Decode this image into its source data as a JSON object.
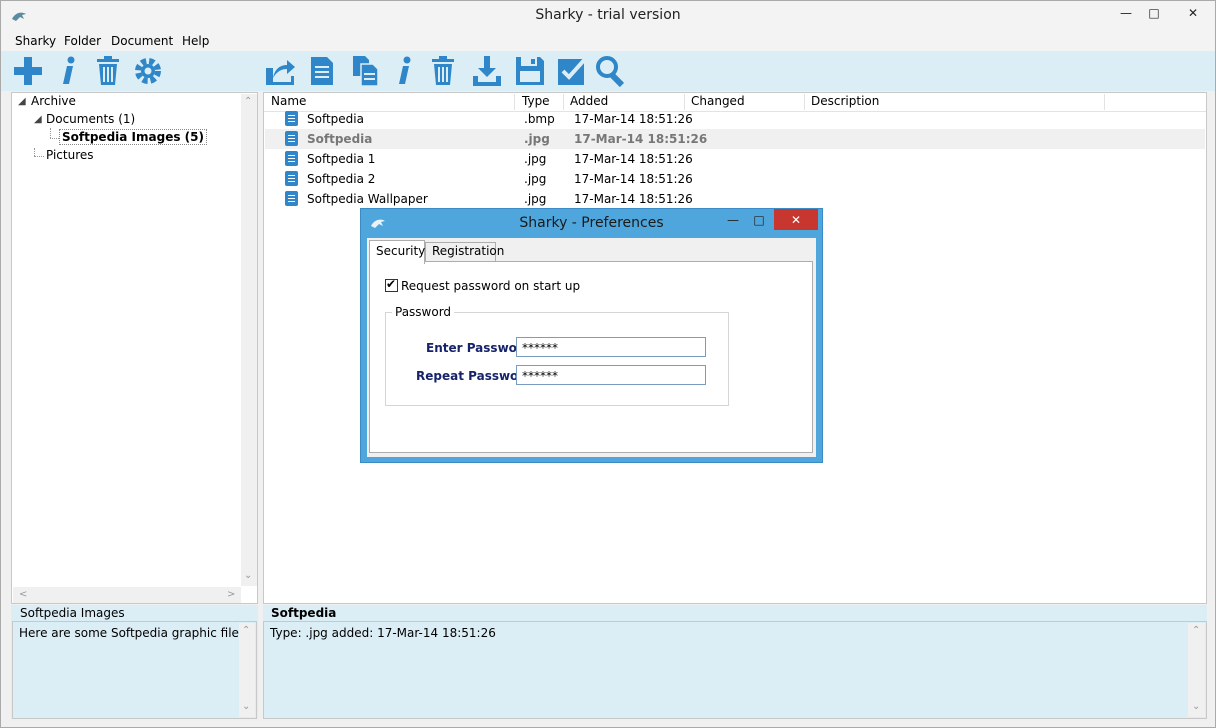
{
  "window": {
    "title": "Sharky - trial version"
  },
  "menu": [
    "Sharky",
    "Folder",
    "Document",
    "Help"
  ],
  "toolbar_left": [
    "add-icon",
    "info-icon",
    "trash-icon",
    "gear-icon"
  ],
  "toolbar_right": [
    "export-icon",
    "document-icon",
    "copy-icon",
    "info-icon",
    "trash-icon",
    "download-icon",
    "save-icon",
    "check-icon",
    "search-icon"
  ],
  "tree": {
    "root": "Archive",
    "children": [
      {
        "label": "Documents (1)"
      },
      {
        "label": "Softpedia Images (5)",
        "selected": true
      },
      {
        "label": "Pictures"
      }
    ]
  },
  "file_list": {
    "columns": [
      "Name",
      "Type",
      "Added",
      "Changed",
      "Description"
    ],
    "rows": [
      {
        "name": "Softpedia",
        "type": ".bmp",
        "added": "17-Mar-14 18:51:26"
      },
      {
        "name": "Softpedia",
        "type": ".jpg",
        "added": "17-Mar-14 18:51:26",
        "selected": true
      },
      {
        "name": "Softpedia 1",
        "type": ".jpg",
        "added": "17-Mar-14 18:51:26"
      },
      {
        "name": "Softpedia 2",
        "type": ".jpg",
        "added": "17-Mar-14 18:51:26"
      },
      {
        "name": "Softpedia Wallpaper",
        "type": ".jpg",
        "added": "17-Mar-14 18:51:26"
      }
    ]
  },
  "bottom_left": {
    "title": "Softpedia Images",
    "note": "Here are some Softpedia graphic files"
  },
  "bottom_right": {
    "title": "Softpedia",
    "note": "Type: .jpg added: 17-Mar-14 18:51:26"
  },
  "dialog": {
    "title": "Sharky - Preferences",
    "tabs": [
      "Security",
      "Registration"
    ],
    "checkbox_label": "Request password on start up",
    "checkbox_checked": true,
    "group_label": "Password",
    "enter_label": "Enter Password",
    "enter_value": "******",
    "repeat_label": "Repeat Password",
    "repeat_value": "******"
  },
  "colors": {
    "accent": "#2f86c8",
    "toolbar_bg": "#dceef5",
    "dialog_frame": "#4ea6dc",
    "close": "#c7372f"
  }
}
